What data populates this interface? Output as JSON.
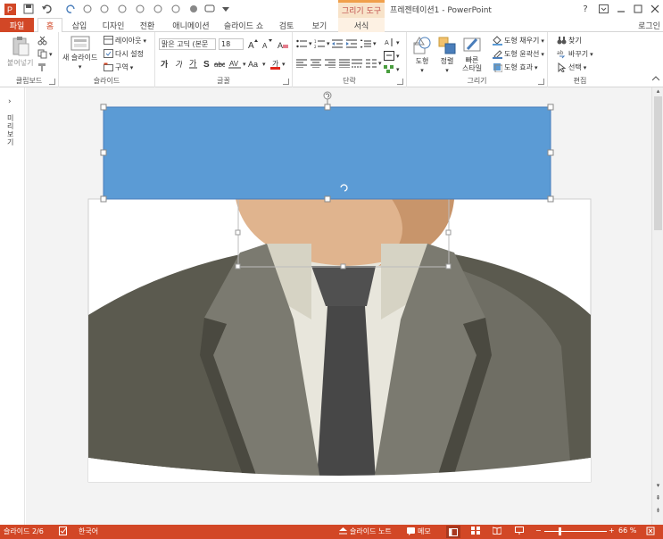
{
  "window": {
    "title": "프레젠테이션1 - PowerPoint",
    "context_tab_group": "그리기 도구",
    "help": "?",
    "signin": "로그인"
  },
  "tabs": {
    "file": "파일",
    "home": "홈",
    "insert": "삽입",
    "design": "디자인",
    "transitions": "전환",
    "animations": "애니메이션",
    "slideshow": "슬라이드 쇼",
    "review": "검토",
    "view": "보기",
    "format": "서식"
  },
  "ribbon": {
    "clipboard": {
      "label": "클립보드",
      "paste": "붙여넣기"
    },
    "slides": {
      "label": "슬라이드",
      "new_slide": "새 슬라이드",
      "layout": "레이아웃",
      "reset": "다시 설정",
      "section": "구역"
    },
    "font": {
      "label": "글꼴",
      "font_name": "맑은 고딕 (본문",
      "font_size": "18"
    },
    "paragraph": {
      "label": "단락"
    },
    "drawing": {
      "label": "그리기",
      "shapes": "도형",
      "arrange": "정렬",
      "quick_styles": "빠른\n스타일",
      "fill": "도형 채우기",
      "outline": "도형 윤곽선",
      "effects": "도형 효과"
    },
    "editing": {
      "label": "편집",
      "find": "찾기",
      "replace": "바꾸기",
      "select": "선택"
    }
  },
  "leftpane": {
    "label": "미리 보기"
  },
  "status": {
    "slide": "슬라이드 2/6",
    "language": "한국어",
    "notes": "슬라이드 노트",
    "comments": "메모",
    "zoom": "66 %"
  },
  "colors": {
    "accent": "#d24726",
    "shape_fill": "#5b9bd5",
    "suit_dark": "#5b5a4f",
    "suit_mid": "#6f6e64",
    "tie": "#4a4a4a",
    "shirt": "#e8e6dc",
    "skin": "#e0b48e"
  }
}
